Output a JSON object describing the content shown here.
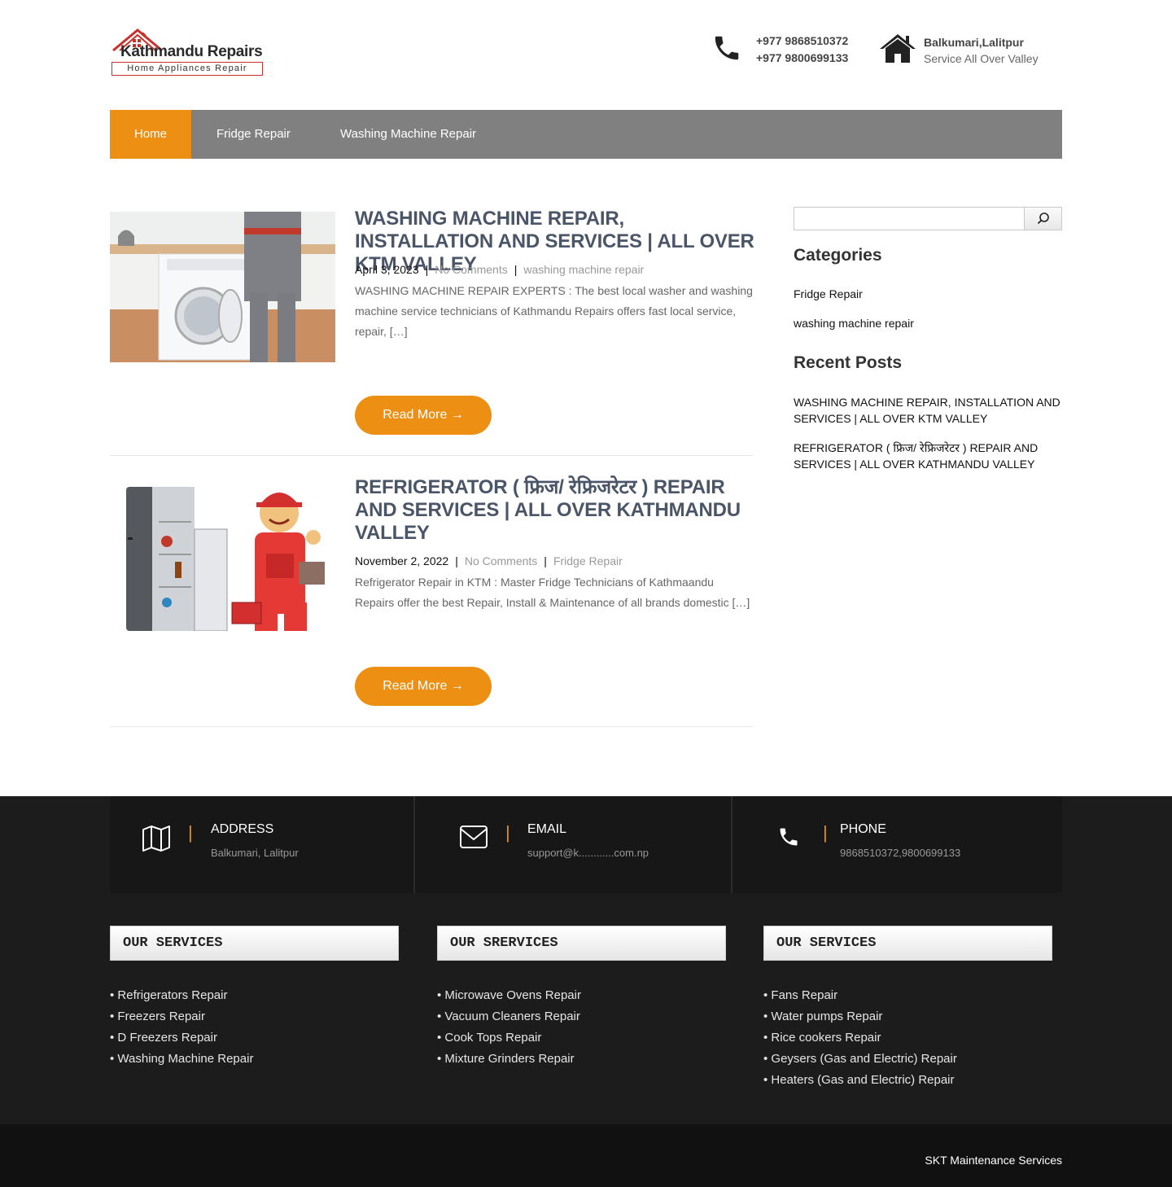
{
  "header": {
    "logo": {
      "title": "Kathmandu Repairs",
      "subtitle": "Home Appliances Repair"
    },
    "phone": {
      "icon": "phone-icon",
      "line1": "+977 9868510372",
      "line2": "+977 9800699133"
    },
    "location": {
      "icon": "home-icon",
      "line1": "Balkumari,Lalitpur",
      "line2": "Service All Over Valley"
    }
  },
  "nav": {
    "items": [
      {
        "label": "Home",
        "active": true
      },
      {
        "label": "Fridge Repair",
        "active": false
      },
      {
        "label": "Washing Machine Repair",
        "active": false
      }
    ]
  },
  "posts": [
    {
      "title": "WASHING MACHINE REPAIR, INSTALLATION AND SERVICES | ALL OVER KTM VALLEY",
      "date": "April 3, 2023",
      "comments": "No Comments",
      "category": "washing machine repair",
      "excerpt": "WASHING MACHINE REPAIR EXPERTS : The best local washer and washing machine service technicians of Kathmandu Repairs offers fast local service, repair, […]",
      "read_more": "Read More →"
    },
    {
      "title": "REFRIGERATOR ( फ्रिज/ रेफ्रिजरेटर ) REPAIR AND SERVICES | ALL OVER KATHMANDU VALLEY",
      "date": "November 2, 2022",
      "comments": "No Comments",
      "category": "Fridge Repair",
      "excerpt": "Refrigerator Repair in KTM : Master Fridge Technicians of Kathmaandu Repairs offer the best Repair, Install & Maintenance of all brands domestic […]",
      "read_more": "Read More →"
    }
  ],
  "sidebar": {
    "search": {
      "value": "",
      "placeholder": "",
      "icon": "search-icon"
    },
    "categories_title": "Categories",
    "categories": [
      "Fridge Repair",
      "washing machine repair"
    ],
    "recent_title": "Recent Posts",
    "recent": [
      "WASHING MACHINE REPAIR, INSTALLATION AND SERVICES | ALL OVER KTM VALLEY",
      "REFRIGERATOR ( फ्रिज/ रेफ्रिजरेटर ) REPAIR AND SERVICES | ALL OVER KATHMANDU VALLEY"
    ]
  },
  "footer": {
    "cards": [
      {
        "icon": "map-icon",
        "title": "ADDRESS",
        "value": "Balkumari, Lalitpur"
      },
      {
        "icon": "envelope-icon",
        "title": "EMAIL",
        "value": "support@k............com.np"
      },
      {
        "icon": "phone-icon",
        "title": "PHONE",
        "value": "9868510372,9800699133"
      }
    ],
    "services": [
      {
        "title": "OUR SERVICES",
        "items": [
          "• Refrigerators Repair",
          "• Freezers Repair",
          "• D Freezers Repair",
          "• Washing Machine Repair"
        ]
      },
      {
        "title": "OUR SRERVICES",
        "items": [
          "• Microwave Ovens Repair",
          "• Vacuum Cleaners Repair",
          "• Cook Tops Repair",
          "• Mixture Grinders Repair"
        ]
      },
      {
        "title": "OUR SERVICES",
        "items": [
          "• Fans Repair",
          "• Water pumps Repair",
          "• Rice cookers Repair",
          "• Geysers (Gas and Electric) Repair",
          "• Heaters (Gas and Electric) Repair"
        ]
      }
    ],
    "credit": "SKT Maintenance Services"
  },
  "colors": {
    "accent": "#ec8f12",
    "nav_bg": "#808080",
    "footer_bg": "#1c1c1c",
    "title": "#4a5568"
  }
}
